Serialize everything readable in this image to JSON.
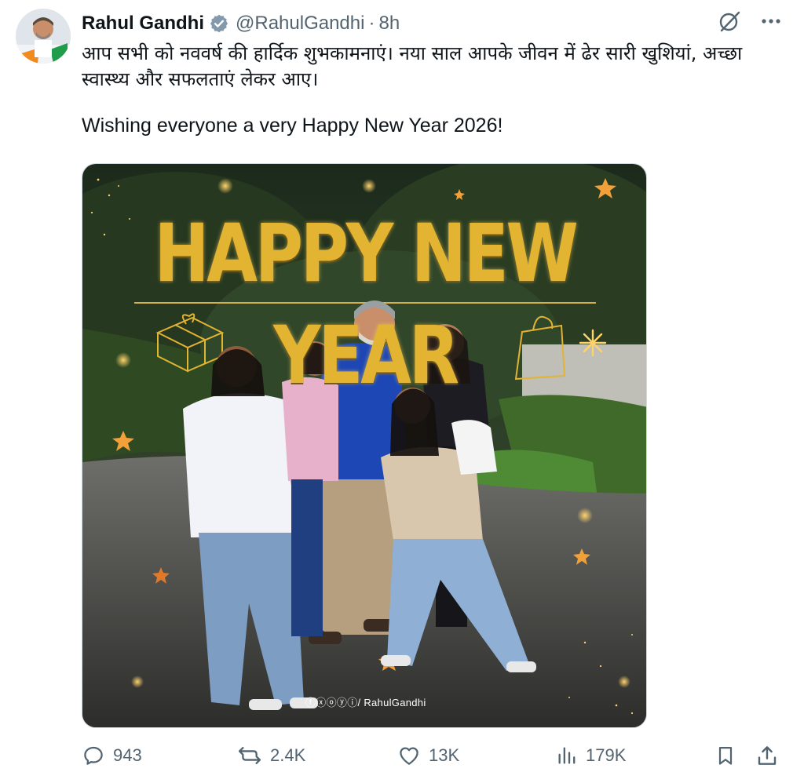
{
  "author": {
    "display_name": "Rahul Gandhi",
    "handle": "@RahulGandhi",
    "separator": "·",
    "time": "8h",
    "verified": true
  },
  "tweet": {
    "hindi_line_1": "आप सभी को नववर्ष की हार्दिक शुभकामनाएं। नया साल आपके जीवन में ढेर सारी खुशियां, अच्छा",
    "hindi_line_2": "स्वास्थ्य और सफलताएं लेकर आए।",
    "english": "Wishing everyone a very Happy New Year 2026!"
  },
  "media": {
    "banner": "HAPPY NEW YEAR",
    "watermark": "ⓕⓧⓞⓨⓘ/ RahulGandhi"
  },
  "stats": {
    "replies": "943",
    "reposts": "2.4K",
    "likes": "13K",
    "views": "179K"
  },
  "icons": {
    "verified": "verified-badge-icon",
    "grok": "grok-icon",
    "more": "more-icon",
    "reply": "reply-icon",
    "repost": "repost-icon",
    "like": "like-icon",
    "views": "views-icon",
    "bookmark": "bookmark-icon",
    "share": "share-icon"
  },
  "colors": {
    "text_primary": "#0f1419",
    "text_secondary": "#536471",
    "verified_badge": "#829aab",
    "gold": "#e3b332"
  }
}
